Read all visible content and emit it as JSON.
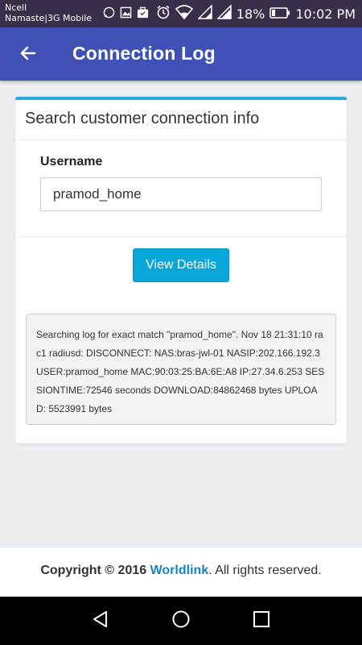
{
  "status_bar": {
    "carrier_line1": "Ncell",
    "carrier_line2": "Namaste|3G Mobile",
    "battery_percent": "18%",
    "time": "10:02 PM",
    "icons": [
      "whatsapp-icon",
      "image-icon",
      "briefcase-icon",
      "alarm-icon",
      "wifi-icon",
      "signal-icon",
      "signal-icon",
      "battery-icon"
    ]
  },
  "app_bar": {
    "title": "Connection Log",
    "back_icon": "arrow-left-icon"
  },
  "card": {
    "header": "Search customer connection info",
    "username_label": "Username",
    "username_value": "pramod_home",
    "view_button_label": "View Details",
    "log_text": "Searching log for exact match \"pramod_home\". Nov 18 21:31:10 rac1 radiusd: DISCONNECT: NAS:bras-jwl-01 NASIP:202.166.192.3 USER:pramod_home MAC:90:03:25:BA:6E:A8 IP:27.34.6.253 SESSIONTIME:72546 seconds DOWNLOAD:84862468 bytes UPLOAD: 5523991 bytes"
  },
  "footer": {
    "copyright": "Copyright © 2016",
    "brand": "Worldlink",
    "suffix": ". All rights reserved."
  },
  "colors": {
    "app_bar": "#3f51b5",
    "accent": "#29a8e0",
    "button": "#09a7d9",
    "brand_link": "#1a82c4"
  }
}
